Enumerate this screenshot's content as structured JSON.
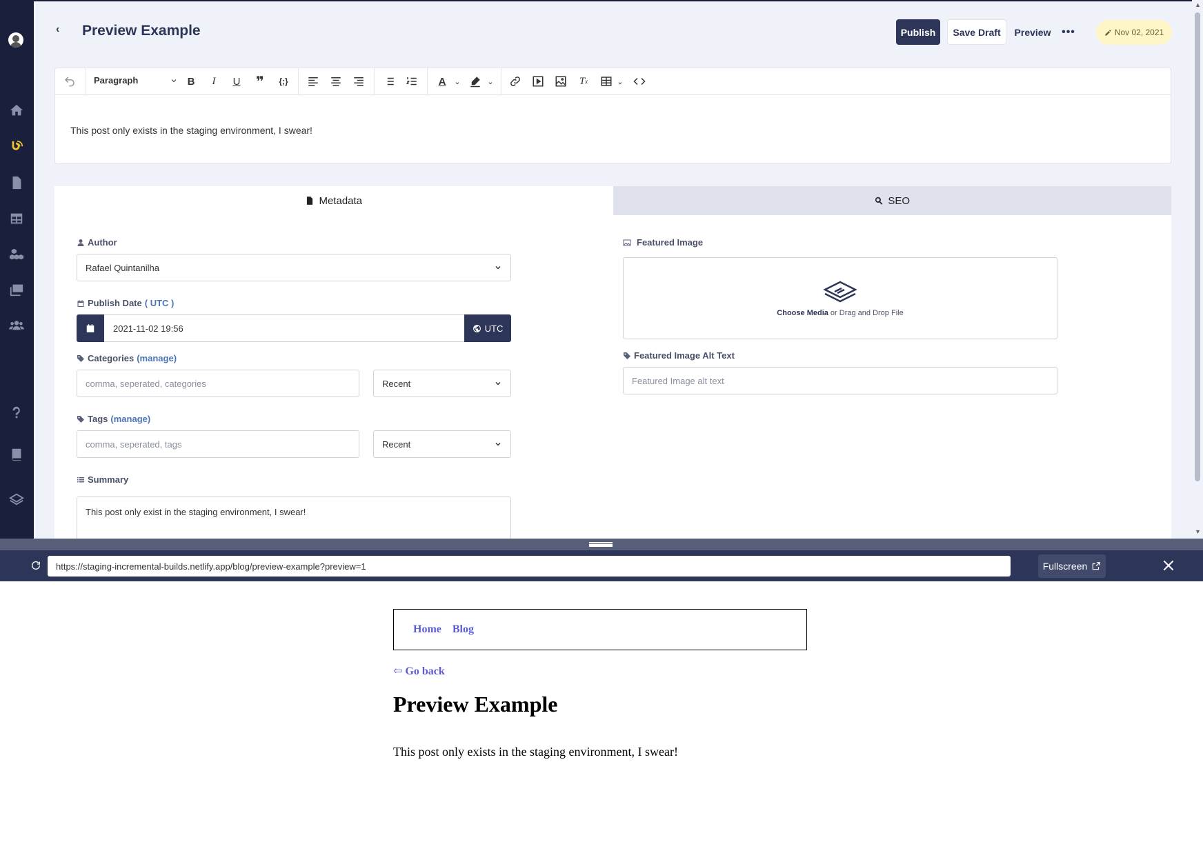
{
  "header": {
    "title": "Preview Example",
    "back_label": "‹",
    "publish_label": "Publish",
    "save_draft_label": "Save Draft",
    "preview_label": "Preview",
    "more_label": "•••",
    "date_label": "Nov 02, 2021"
  },
  "editor": {
    "block_format": "Paragraph",
    "content": "This post only exists in the staging environment, I swear!"
  },
  "tabs": [
    {
      "label": "Metadata",
      "icon": "file-icon",
      "active": true
    },
    {
      "label": "SEO",
      "icon": "search-icon",
      "active": false
    }
  ],
  "metadata": {
    "author_label": "Author",
    "author_value": "Rafael Quintanilha",
    "publish_date_label": "Publish Date",
    "publish_date_tz_link": "UTC",
    "publish_date_value": "2021-11-02 19:56",
    "timezone_button": "UTC",
    "categories_label": "Categories",
    "categories_manage": "manage",
    "categories_placeholder": "comma, seperated, categories",
    "categories_select": "Recent",
    "tags_label": "Tags",
    "tags_manage": "manage",
    "tags_placeholder": "comma, seperated, tags",
    "tags_select": "Recent",
    "summary_label": "Summary",
    "summary_value": "This post only exist in the staging environment, I swear!",
    "featured_image_label": "Featured Image",
    "choose_media": "Choose Media",
    "drag_drop": " or Drag and Drop File",
    "alt_text_label": "Featured Image Alt Text",
    "alt_text_placeholder": "Featured Image alt text"
  },
  "preview_bar": {
    "url": "https://staging-incremental-builds.netlify.app/blog/preview-example?preview=1",
    "fullscreen_label": "Fullscreen"
  },
  "preview_page": {
    "nav": [
      "Home",
      "Blog"
    ],
    "go_back": "⇦ Go back",
    "title": "Preview Example",
    "body": "This post only exists in the staging environment, I swear!"
  },
  "colors": {
    "sidebar": "#1a1f3c",
    "primary": "#2d3558",
    "accent_yellow": "#f2c12e",
    "link": "#5b5bd6"
  }
}
